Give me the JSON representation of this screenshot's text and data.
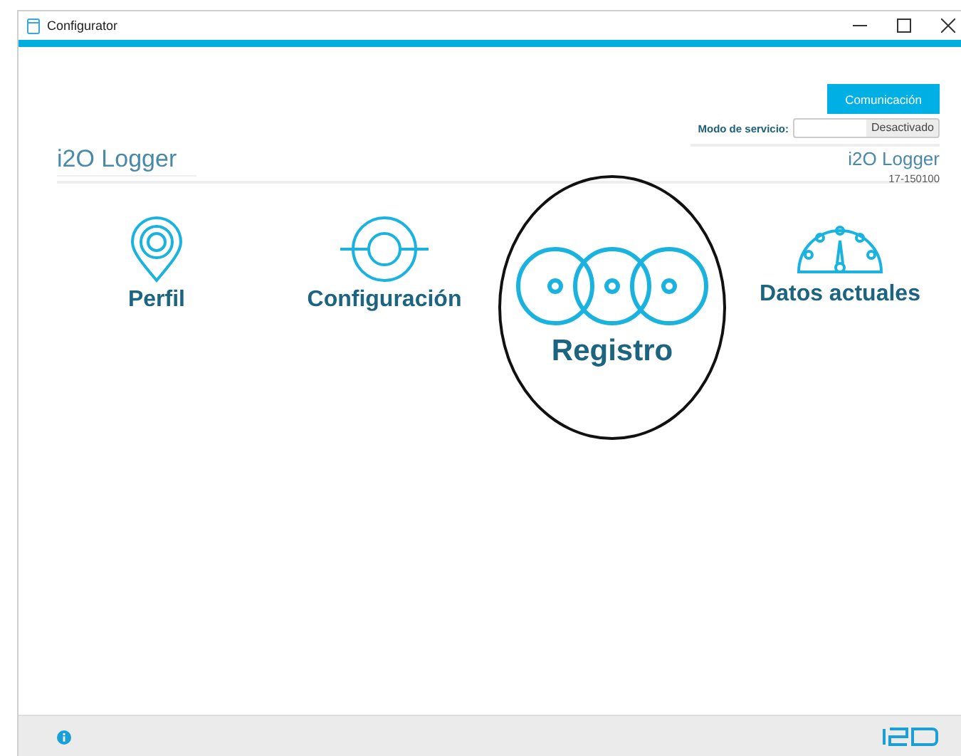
{
  "window": {
    "title": "Configurator"
  },
  "communication_button": "Comunicación",
  "service_mode": {
    "label": "Modo de servicio:",
    "value": "Desactivado"
  },
  "device": {
    "name": "i2O Logger",
    "serial": "17-150100"
  },
  "page_title": "i2O Logger",
  "menu": [
    {
      "kind": "pin",
      "label": "Perfil",
      "selected": false
    },
    {
      "kind": "target",
      "label": "Configuración",
      "selected": false
    },
    {
      "kind": "rings",
      "label": "Registro",
      "selected": true
    },
    {
      "kind": "gauge",
      "label": "Datos actuales",
      "selected": false
    }
  ]
}
